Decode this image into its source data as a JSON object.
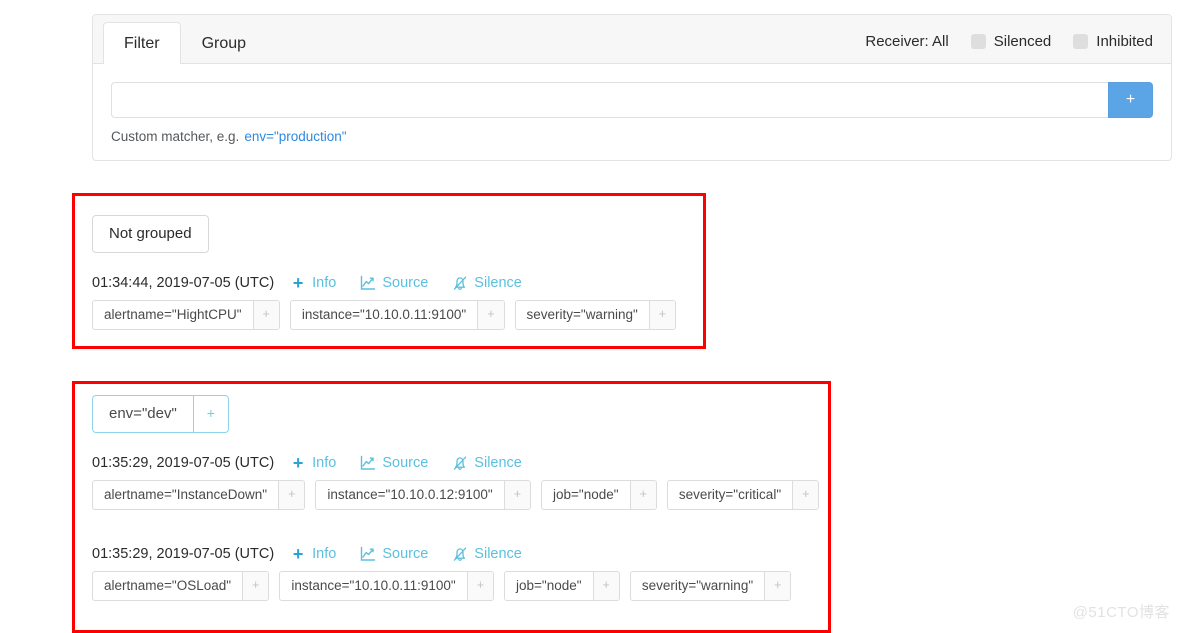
{
  "filter_card": {
    "tabs": [
      {
        "label": "Filter",
        "active": true
      },
      {
        "label": "Group",
        "active": false
      }
    ],
    "receiver_label": "Receiver: All",
    "checkboxes": [
      {
        "label": "Silenced",
        "checked": false
      },
      {
        "label": "Inhibited",
        "checked": false
      }
    ],
    "matcher_input": {
      "value": "",
      "placeholder": ""
    },
    "add_button_label": "+",
    "hint_text": "Custom matcher, e.g.",
    "hint_code": "env=\"production\"",
    "accent_color": "#5ba4e5"
  },
  "action_labels": {
    "info": "Info",
    "source": "Source",
    "silence": "Silence"
  },
  "plus_label": "+",
  "groups": [
    {
      "header_type": "button",
      "header_label": "Not grouped",
      "alerts": [
        {
          "timestamp": "01:34:44, 2019-07-05 (UTC)",
          "labels": [
            "alertname=\"HightCPU\"",
            "instance=\"10.10.0.11:9100\"",
            "severity=\"warning\""
          ]
        }
      ]
    },
    {
      "header_type": "tag",
      "header_label": "env=\"dev\"",
      "alerts": [
        {
          "timestamp": "01:35:29, 2019-07-05 (UTC)",
          "labels": [
            "alertname=\"InstanceDown\"",
            "instance=\"10.10.0.12:9100\"",
            "job=\"node\"",
            "severity=\"critical\""
          ]
        },
        {
          "timestamp": "01:35:29, 2019-07-05 (UTC)",
          "labels": [
            "alertname=\"OSLoad\"",
            "instance=\"10.10.0.11:9100\"",
            "job=\"node\"",
            "severity=\"warning\""
          ]
        }
      ]
    }
  ],
  "highlight_color": "#ff0000",
  "watermark": "@51CTO博客"
}
